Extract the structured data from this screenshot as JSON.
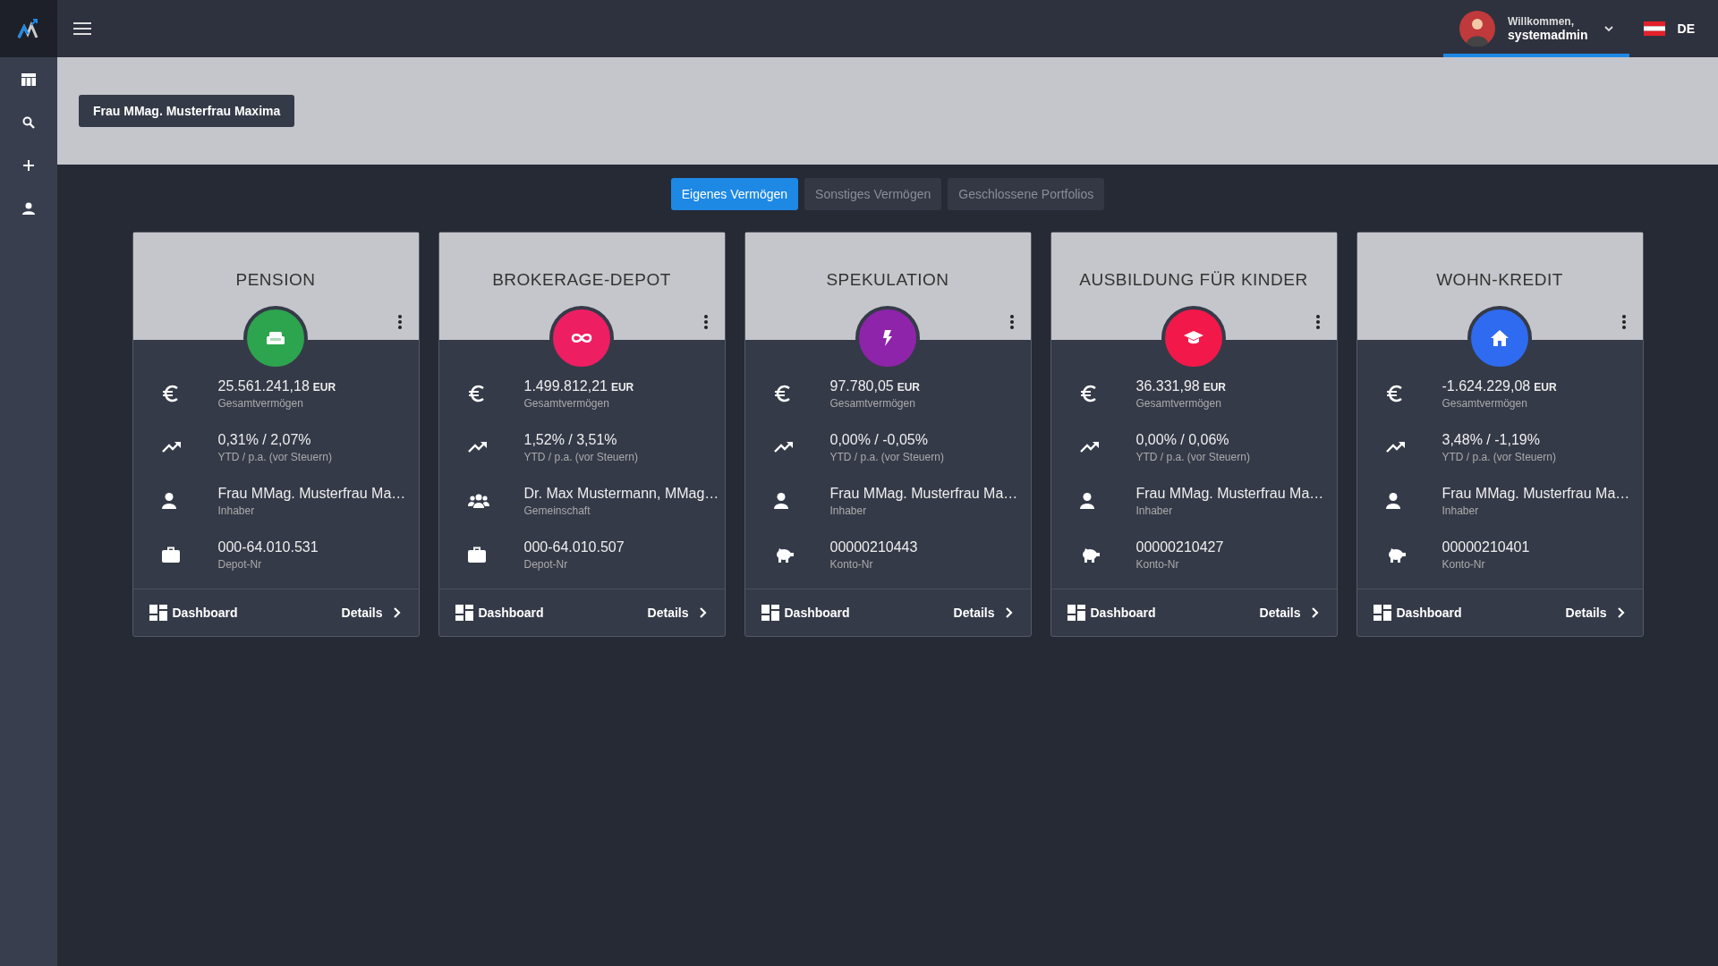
{
  "topbar": {
    "welcome": "Willkommen,",
    "username": "systemadmin",
    "language": "DE"
  },
  "client_badge": "Frau MMag. Musterfrau Maxima",
  "tabs": [
    {
      "label": "Eigenes Vermögen",
      "selected": true
    },
    {
      "label": "Sonstiges Vermögen",
      "selected": false
    },
    {
      "label": "Geschlossene Portfolios",
      "selected": false
    }
  ],
  "cards": [
    {
      "title": "PENSION",
      "kind": "sofa",
      "color": "#2da44e",
      "dashboard": "Dashboard",
      "details": "Details",
      "rows": [
        {
          "kind": "total",
          "value": "25.561.241,18",
          "unit": "EUR",
          "label": "Gesamtvermögen"
        },
        {
          "kind": "performance",
          "value": "0,31% / 2,07%",
          "label": "YTD / p.a. (vor Steuern)"
        },
        {
          "kind": "person",
          "value": "Frau MMag. Musterfrau Ma…",
          "label": "Inhaber"
        },
        {
          "kind": "briefcase",
          "value": "000-64.010.531",
          "label": "Depot-Nr"
        }
      ]
    },
    {
      "title": "BROKERAGE-DEPOT",
      "kind": "infinity",
      "color": "#ee1e63",
      "dashboard": "Dashboard",
      "details": "Details",
      "rows": [
        {
          "kind": "total",
          "value": "1.499.812,21",
          "unit": "EUR",
          "label": "Gesamtvermögen"
        },
        {
          "kind": "performance",
          "value": "1,52% / 3,51%",
          "label": "YTD / p.a. (vor Steuern)"
        },
        {
          "kind": "group",
          "value": "Dr. Max Mustermann, MMag…",
          "label": "Gemeinschaft"
        },
        {
          "kind": "briefcase",
          "value": "000-64.010.507",
          "label": "Depot-Nr"
        }
      ]
    },
    {
      "title": "SPEKULATION",
      "kind": "bolt",
      "color": "#8e24aa",
      "dashboard": "Dashboard",
      "details": "Details",
      "rows": [
        {
          "kind": "total",
          "value": "97.780,05",
          "unit": "EUR",
          "label": "Gesamtvermögen"
        },
        {
          "kind": "performance",
          "value": "0,00% / -0,05%",
          "label": "YTD / p.a. (vor Steuern)"
        },
        {
          "kind": "person",
          "value": "Frau MMag. Musterfrau Ma…",
          "label": "Inhaber"
        },
        {
          "kind": "piggy",
          "value": "00000210443",
          "label": "Konto-Nr"
        }
      ]
    },
    {
      "title": "AUSBILDUNG FÜR KINDER",
      "kind": "graduation",
      "color": "#f2184a",
      "dashboard": "Dashboard",
      "details": "Details",
      "rows": [
        {
          "kind": "total",
          "value": "36.331,98",
          "unit": "EUR",
          "label": "Gesamtvermögen"
        },
        {
          "kind": "performance",
          "value": "0,00% / 0,06%",
          "label": "YTD / p.a. (vor Steuern)"
        },
        {
          "kind": "person",
          "value": "Frau MMag. Musterfrau Ma…",
          "label": "Inhaber"
        },
        {
          "kind": "piggy",
          "value": "00000210427",
          "label": "Konto-Nr"
        }
      ]
    },
    {
      "title": "WOHN-KREDIT",
      "kind": "home",
      "color": "#2f6bf0",
      "dashboard": "Dashboard",
      "details": "Details",
      "rows": [
        {
          "kind": "total",
          "value": "-1.624.229,08",
          "unit": "EUR",
          "label": "Gesamtvermögen"
        },
        {
          "kind": "performance",
          "value": "3,48% / -1,19%",
          "label": "YTD / p.a. (vor Steuern)"
        },
        {
          "kind": "person",
          "value": "Frau MMag. Musterfrau Ma…",
          "label": "Inhaber"
        },
        {
          "kind": "piggy",
          "value": "00000210401",
          "label": "Konto-Nr"
        }
      ]
    }
  ]
}
